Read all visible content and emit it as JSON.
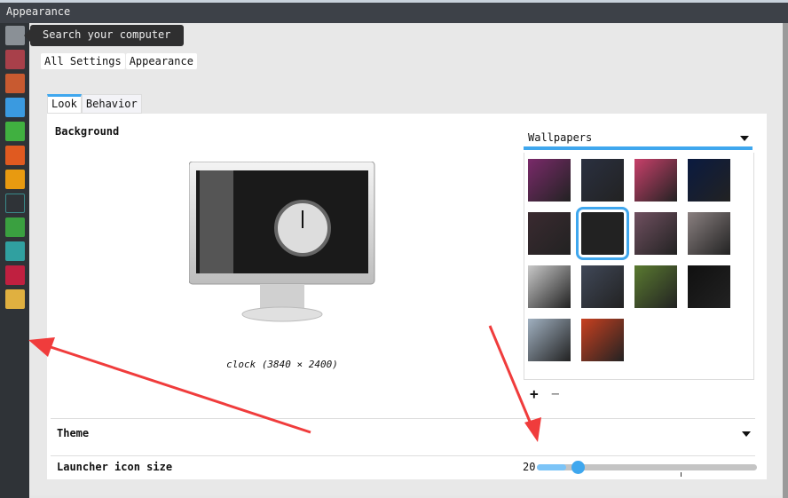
{
  "window": {
    "title": "Appearance"
  },
  "tooltip": "Search your computer",
  "breadcrumb": [
    "All Settings",
    "Appearance"
  ],
  "tabs": [
    {
      "label": "Look",
      "active": true
    },
    {
      "label": "Behavior",
      "active": false
    }
  ],
  "background": {
    "heading": "Background",
    "caption": "clock (3840 × 2400)"
  },
  "wallpapers": {
    "selected": "Wallpapers",
    "add": "+",
    "remove": "−",
    "thumbs": [
      "#7a2a6a",
      "#2a3040",
      "#c8406a",
      "#0a1a40",
      "#3a2a30",
      "#222",
      "#705060",
      "#8a8080",
      "#c8c8c8",
      "#404858",
      "#5a7a30",
      "#101010",
      "#a0b0c0",
      "#c84020"
    ]
  },
  "theme": {
    "label": "Theme"
  },
  "launcher_size": {
    "label": "Launcher icon size",
    "value": "20",
    "fraction": 0.1
  },
  "launcher": [
    "search",
    "files",
    "firefox",
    "writer",
    "calc",
    "impress",
    "amazon",
    "system-settings",
    "terminal",
    "update",
    "sound-mixer",
    "app-grid"
  ],
  "colors": {
    "accent": "#3fa7ee",
    "arrow": "#f03c3c"
  }
}
